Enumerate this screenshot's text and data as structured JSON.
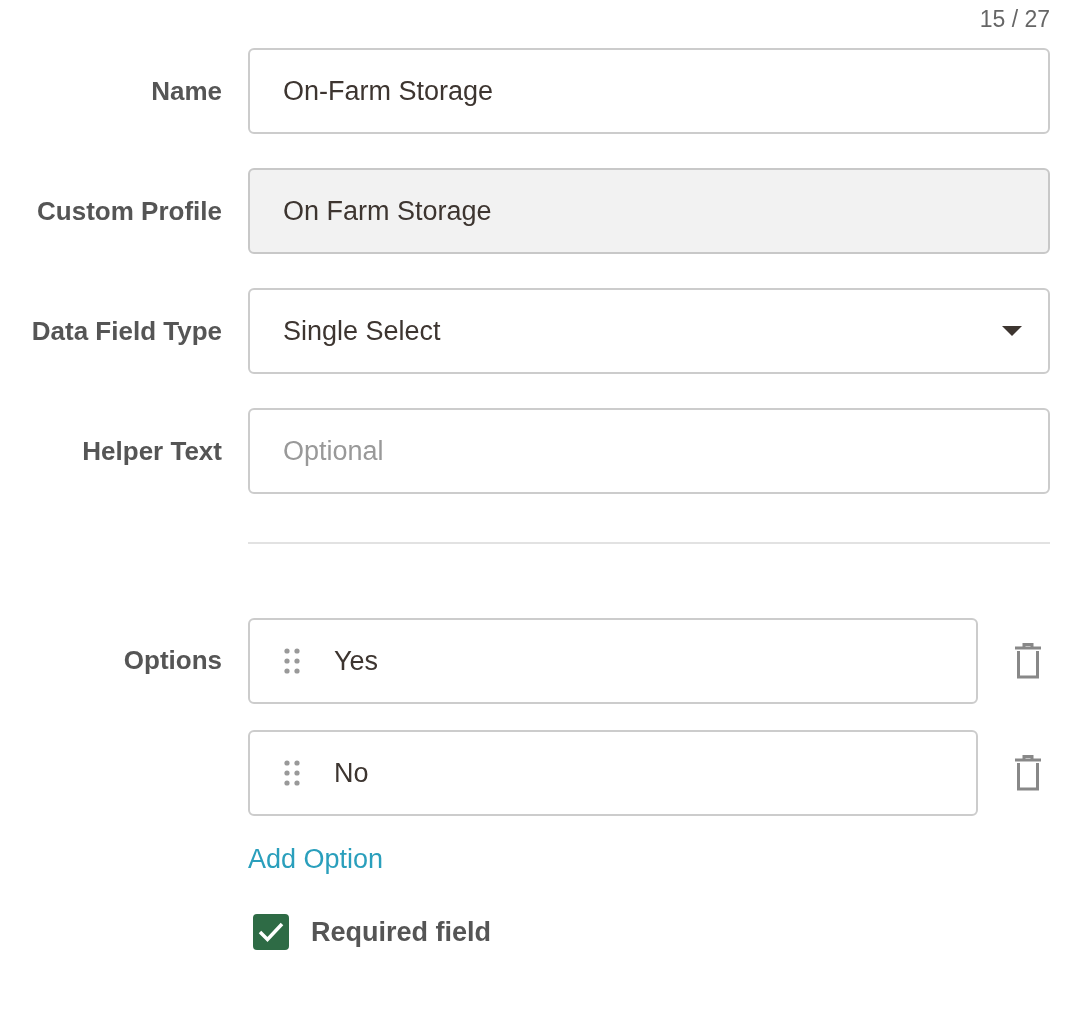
{
  "counter": "15 / 27",
  "fields": [
    {
      "label": "Name",
      "kind": "text",
      "value": "On-Farm Storage",
      "disabled": false
    },
    {
      "label": "Custom Profile",
      "kind": "text",
      "value": "On Farm Storage",
      "disabled": true
    },
    {
      "label": "Data Field Type",
      "kind": "select",
      "value": "Single Select",
      "disabled": false
    },
    {
      "label": "Helper Text",
      "kind": "text",
      "placeholder": "Optional",
      "disabled": false
    }
  ],
  "options": {
    "label": "Options",
    "items": [
      {
        "value": "Yes"
      },
      {
        "value": "No"
      }
    ],
    "add_link": "Add Option"
  },
  "required": {
    "label": "Required field",
    "checked": true
  }
}
